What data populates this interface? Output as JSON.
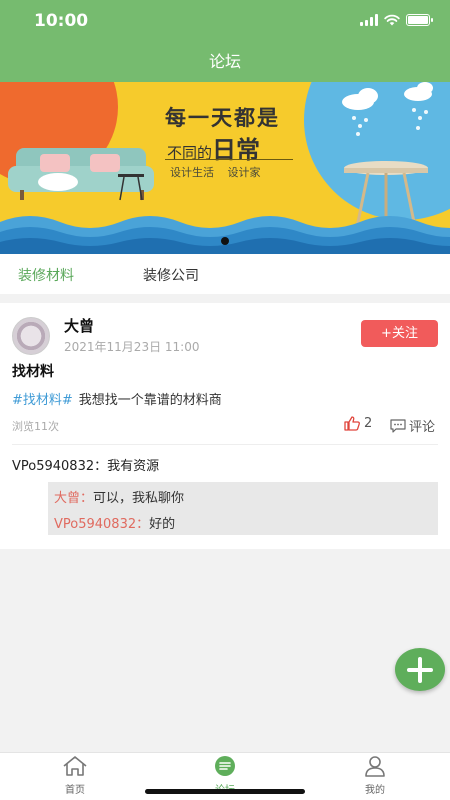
{
  "status_bar": {
    "time": "10:00"
  },
  "nav": {
    "title": "论坛"
  },
  "banner": {
    "title_line1": "每一天都是",
    "title_line2_prefix": "不同的",
    "title_line2_emph": "日常",
    "subtitle": "设计生活  设计家"
  },
  "tabs": [
    {
      "label": "装修材料",
      "active": true
    },
    {
      "label": "装修公司",
      "active": false
    }
  ],
  "post": {
    "author": "大曾",
    "time": "2021年11月23日 11:00",
    "follow_label": "+关注",
    "title": "找材料",
    "tag": "#找材料#",
    "body": "我想找一个靠谱的材料商",
    "views": "浏览11次",
    "likes": "2",
    "comment_label": "评论",
    "comment": {
      "user": "VPo5940832：",
      "text": "我有资源"
    },
    "replies": [
      {
        "user": "大曾：",
        "text": "可以，我私聊你"
      },
      {
        "user": "VPo5940832：",
        "text": "好的"
      }
    ]
  },
  "tabbar": [
    {
      "label": "首页",
      "icon": "home-icon",
      "active": false
    },
    {
      "label": "论坛",
      "icon": "forum-icon",
      "active": true
    },
    {
      "label": "我的",
      "icon": "user-icon",
      "active": false
    }
  ],
  "colors": {
    "primary": "#76bb6f",
    "accent_red": "#f15b5b",
    "tag_blue": "#3f9bd6",
    "banner_yellow": "#f6cb2c"
  }
}
